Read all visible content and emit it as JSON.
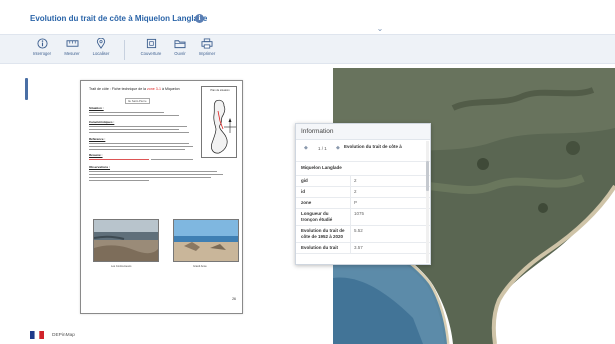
{
  "header": {
    "title": "Evolution du trait de côte à Miquelon Langlade",
    "info_glyph": "i"
  },
  "toolbar": {
    "items": [
      {
        "label": "Interroger",
        "icon": "query-icon"
      },
      {
        "label": "Mesurer",
        "icon": "ruler-icon"
      },
      {
        "label": "Localiser",
        "icon": "location-pin-icon"
      },
      {
        "label": "Couverture",
        "icon": "basemap-icon"
      },
      {
        "label": "Ouvrir",
        "icon": "folder-icon"
      },
      {
        "label": "Imprimer",
        "icon": "printer-icon"
      }
    ]
  },
  "document": {
    "title_main": "Trait de côte : Fiche technique de la ",
    "title_hl": "zone 3-1",
    "title_end": " à Miquelon",
    "subtitle": "Ile Saint-Pierre",
    "minimap_title": "Plan de situation",
    "sections": [
      "Situation :",
      "Caractéristiques :",
      "Référence :",
      "Résumé :",
      "Observations :"
    ],
    "photo_captions": [
      "Les Contrecoeurs",
      "Grand Anse"
    ],
    "page_number": "26"
  },
  "popup": {
    "heading": "Information",
    "nav_prev": "◆",
    "nav_next": "◆",
    "count": "1 / 1",
    "feature_name_1": "Evolution du trait de côte à",
    "feature_name_2": "Miquelon Langlade",
    "rows": [
      {
        "key": "gid",
        "value": "2"
      },
      {
        "key": "id",
        "value": "2"
      },
      {
        "key": "zone",
        "value": "P"
      },
      {
        "key": "Longueur du tronçon étudié",
        "value": "1075"
      },
      {
        "key": "Evolution du trait de côte de 1952 à 2020",
        "value": "5.52"
      },
      {
        "key": "Evolution du trait",
        "value": "3.57"
      }
    ]
  },
  "footer": {
    "text": "DEPinMap"
  }
}
